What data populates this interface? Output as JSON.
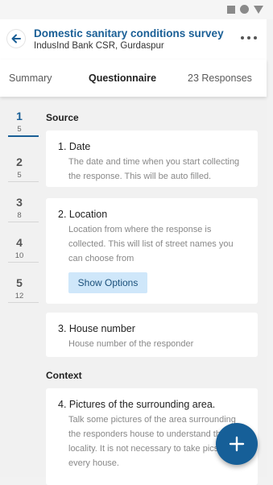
{
  "status_bar": {
    "icons": [
      "square-icon",
      "circle-icon",
      "triangle-icon"
    ]
  },
  "header": {
    "title": "Domestic sanitary conditions survey",
    "subtitle": "IndusInd Bank CSR, Gurdaspur",
    "back_icon": "arrow-left-icon",
    "more_icon": "more-dots-icon",
    "accent_color": "#1a5f96"
  },
  "tabs": [
    {
      "label": "Summary",
      "active": false
    },
    {
      "label": "Questionnaire",
      "active": true
    },
    {
      "label": "23 Responses",
      "active": false
    }
  ],
  "sections_nav": [
    {
      "number": "1",
      "count": "5",
      "active": true
    },
    {
      "number": "2",
      "count": "5",
      "active": false
    },
    {
      "number": "3",
      "count": "8",
      "active": false
    },
    {
      "number": "4",
      "count": "10",
      "active": false
    },
    {
      "number": "5",
      "count": "12",
      "active": false
    }
  ],
  "sections": [
    {
      "title": "Source",
      "questions": [
        {
          "title": "1. Date",
          "description": "The date and time when you start collecting the response. This will be auto filled."
        },
        {
          "title": "2. Location",
          "description": "Location from where the response is collected. This will list of street names you can choose from",
          "button": "Show Options"
        },
        {
          "title": "3. House number",
          "description": "House number of the responder"
        }
      ]
    },
    {
      "title": "Context",
      "questions": [
        {
          "title": "4. Pictures of the surrounding area.",
          "description": "Talk some pictures of the area surrounding the responders house  to understand the locality. It is not necessary to take pics At every house."
        }
      ]
    }
  ],
  "fab": {
    "icon": "plus-icon",
    "color": "#165f98"
  }
}
